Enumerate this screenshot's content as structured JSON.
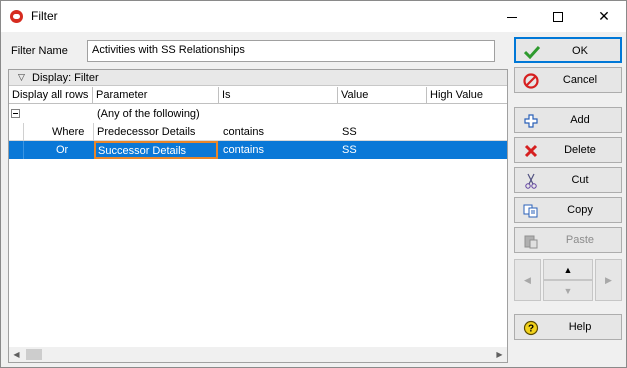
{
  "window": {
    "title": "Filter"
  },
  "filter_name": {
    "label": "Filter Name",
    "value": "Activities with SS Relationships"
  },
  "grid": {
    "group_header": "Display: Filter",
    "columns": [
      "Display all rows",
      "Parameter",
      "Is",
      "Value",
      "High Value"
    ],
    "group_row": {
      "text": "(Any of the following)"
    },
    "rows": [
      {
        "conj": "Where",
        "parameter": "Predecessor Details",
        "is": "contains",
        "value": "SS",
        "high_value": ""
      },
      {
        "conj": "Or",
        "parameter": "Successor Details",
        "is": "contains",
        "value": "SS",
        "high_value": ""
      }
    ],
    "selected_row": 1
  },
  "buttons": {
    "ok": "OK",
    "cancel": "Cancel",
    "add": "Add",
    "delete": "Delete",
    "cut": "Cut",
    "copy": "Copy",
    "paste": "Paste",
    "help": "Help"
  },
  "colors": {
    "selection": "#0a78d7",
    "focus_border": "#e8862a",
    "ok_check": "#2e9a2e",
    "cancel_red": "#d62020",
    "help_yellow": "#f2d21b"
  }
}
